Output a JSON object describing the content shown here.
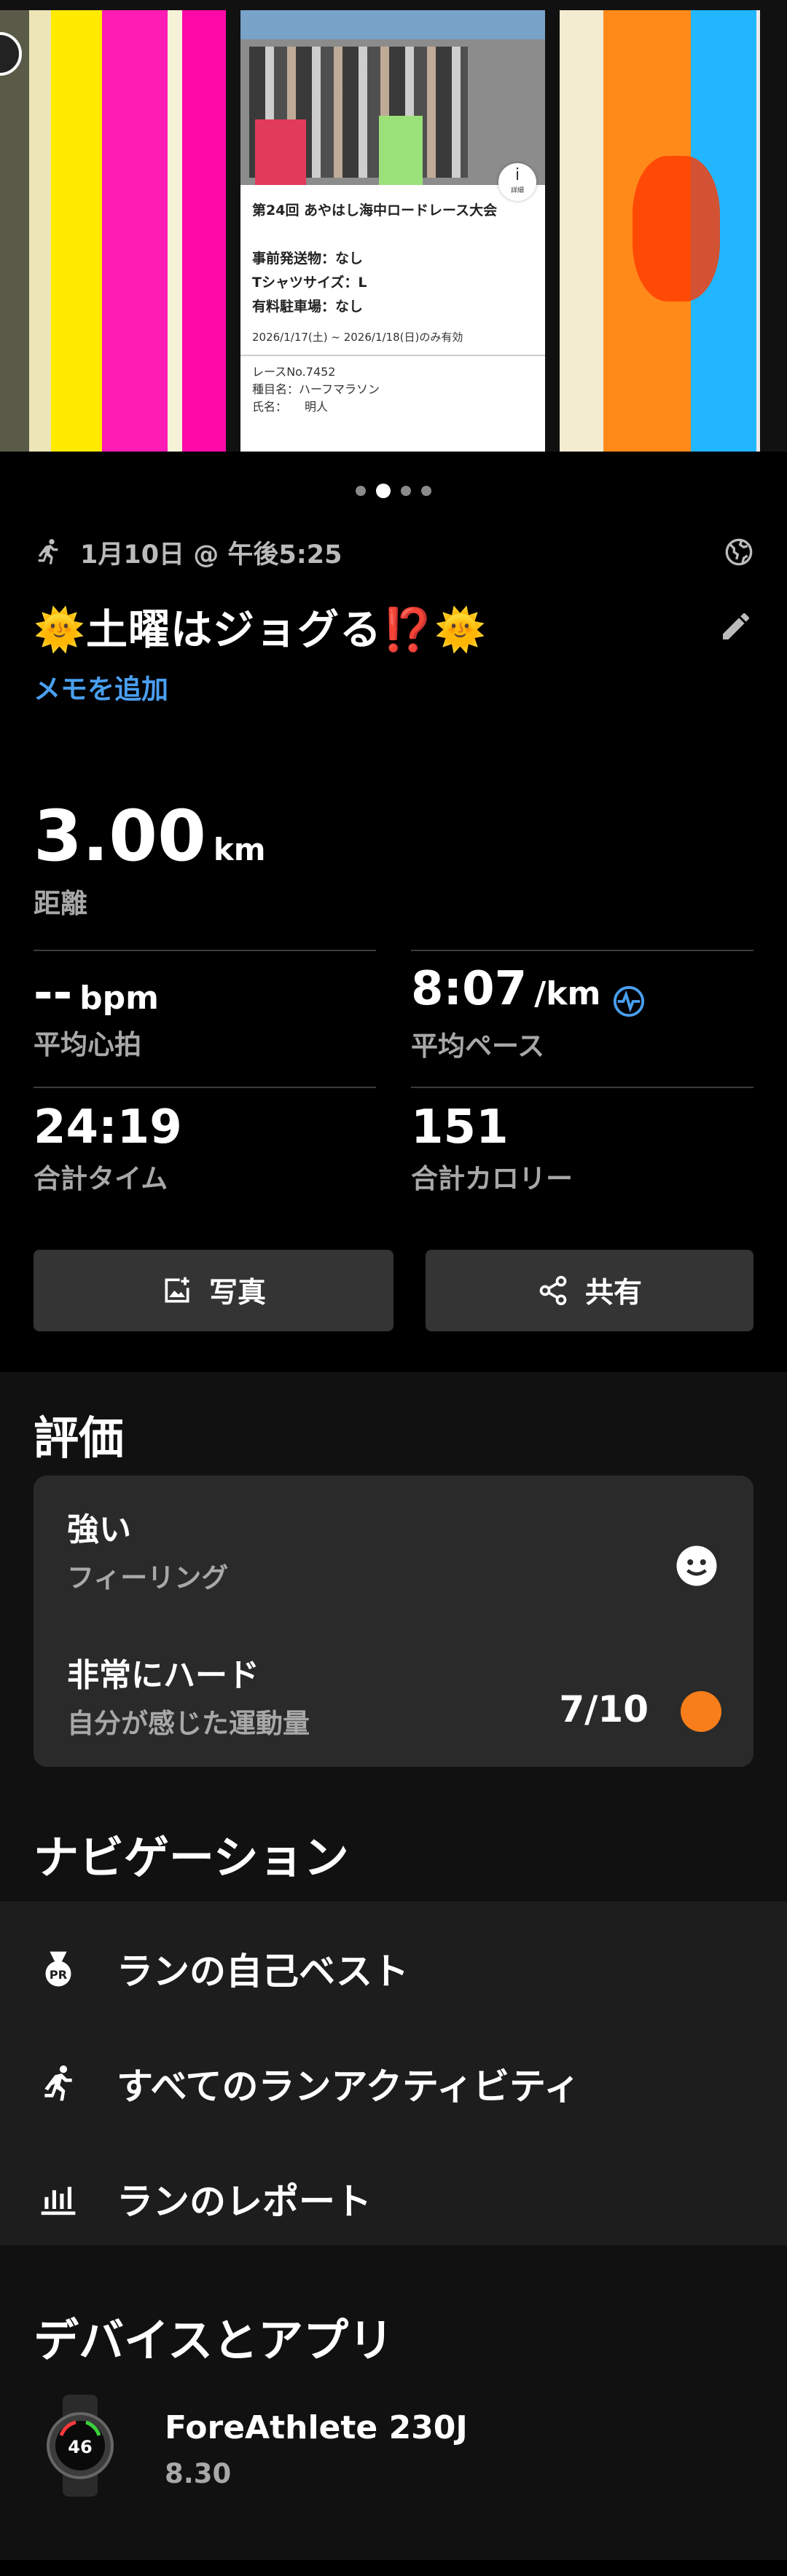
{
  "photos": {
    "card": {
      "title": "第24回 あやはし海中ロードレース大会",
      "lines": [
        "事前発送物：なし",
        "Tシャツサイズ：L",
        "有料駐車場：なし"
      ],
      "validity": "2026/1/17(土) ~ 2026/1/18(日)のみ有効",
      "race_no": "レースNo.7452",
      "event": "種目名：ハーフマラソン",
      "name": "氏名：　　明人",
      "info_label": "詳細"
    },
    "dot_count": 4,
    "active_dot": 1
  },
  "activity": {
    "date": "1月10日 @ 午後5:25",
    "title": "🌞土曜はジョグる⁉️🌞",
    "add_memo": "メモを追加"
  },
  "stats": {
    "distance": {
      "value": "3.00",
      "unit": "km",
      "label": "距離"
    },
    "heart_rate": {
      "value": "--",
      "unit": "bpm",
      "label": "平均心拍"
    },
    "pace": {
      "value": "8:07",
      "unit": "/km",
      "label": "平均ペース"
    },
    "time": {
      "value": "24:19",
      "label": "合計タイム"
    },
    "calories": {
      "value": "151",
      "label": "合計カロリー"
    }
  },
  "buttons": {
    "photo": "写真",
    "share": "共有"
  },
  "evaluation": {
    "title": "評価",
    "feeling": {
      "value": "強い",
      "label": "フィーリング"
    },
    "effort": {
      "value": "非常にハード",
      "label": "自分が感じた運動量",
      "score": "7/10",
      "color": "#f77e1a"
    }
  },
  "navigation": {
    "title": "ナビゲーション",
    "items": [
      {
        "label": "ランの自己ベスト",
        "icon": "pr-medal-icon"
      },
      {
        "label": "すべてのランアクティビティ",
        "icon": "runner-icon"
      },
      {
        "label": "ランのレポート",
        "icon": "bar-chart-icon"
      }
    ]
  },
  "devices": {
    "title": "デバイスとアプリ",
    "name": "ForeAthlete 230J",
    "version": "8.30",
    "watch_face_number": "46"
  },
  "colors": {
    "link": "#4a9ff0",
    "card_bg": "#2a2a2a",
    "button_bg": "#343434"
  }
}
